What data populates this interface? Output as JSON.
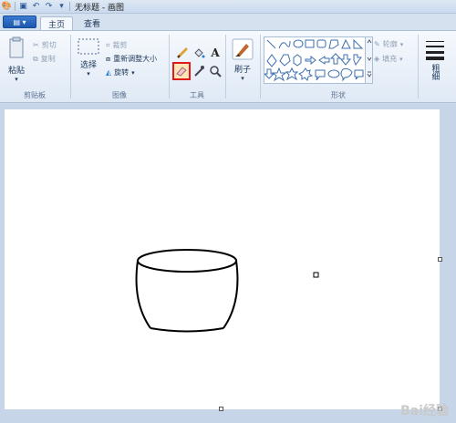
{
  "window": {
    "title": "无标题 - 画图"
  },
  "tabs": {
    "file_label": "▤ ▾",
    "home": "主页",
    "view": "查看"
  },
  "clipboard": {
    "paste": "粘贴",
    "cut": "剪切",
    "copy": "复制",
    "label": "剪贴板"
  },
  "image": {
    "select": "选择",
    "crop": "裁剪",
    "resize": "重新调整大小",
    "rotate": "旋转",
    "label": "图像"
  },
  "tools": {
    "label": "工具",
    "selected_tool": "eraser"
  },
  "brushes": {
    "label": "刷子"
  },
  "shapes": {
    "outline": "轮廓",
    "fill": "填充",
    "label": "形状"
  },
  "size": {
    "label": "粗细"
  },
  "watermark": "Bai经验",
  "colors": {
    "selection_highlight": "#e01b1b",
    "ribbon_bg": "#f6f9fd"
  }
}
